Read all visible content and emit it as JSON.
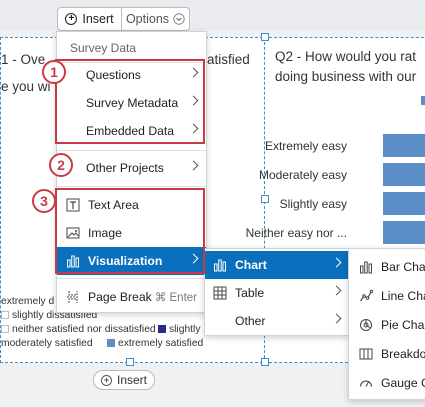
{
  "toolbar": {
    "insert_label": "Insert",
    "options_label": "Options"
  },
  "left_widget": {
    "title_line1": "1 - Ove",
    "title_line1_right": "atisfied",
    "title_line2": "e you wi",
    "legend": [
      {
        "label": "extremely d",
        "color": "#2a2a8a"
      },
      {
        "label": "slightly dissatisfied",
        "color": "#ffffff"
      },
      {
        "label": "neither satisfied nor dissatisfied",
        "color": "#ffffff"
      },
      {
        "label": "slightly",
        "color": "#2a2a8a"
      },
      {
        "label": "moderately satisfied",
        "color": "#ffffff"
      },
      {
        "label": "extremely satisfied",
        "color": "#5b8ec6"
      }
    ]
  },
  "right_widget": {
    "title_line1": "Q2 - How would you rat",
    "title_line2": "doing business with our",
    "chart_data": {
      "type": "bar",
      "categories": [
        "Extremely easy",
        "Moderately easy",
        "Slightly easy",
        "Neither easy nor ..."
      ]
    }
  },
  "bottom_insert_label": "Insert",
  "menu": {
    "header": "Survey Data",
    "items": [
      {
        "label": "Questions"
      },
      {
        "label": "Survey Metadata"
      },
      {
        "label": "Embedded Data"
      },
      {
        "label": "Other Projects"
      },
      {
        "label": "Text Area"
      },
      {
        "label": "Image"
      },
      {
        "label": "Visualization"
      },
      {
        "label": "Page Break",
        "shortcut": "⌘ Enter"
      }
    ]
  },
  "submenu": {
    "items": [
      {
        "label": "Chart"
      },
      {
        "label": "Table"
      },
      {
        "label": "Other"
      }
    ]
  },
  "chart_menu": {
    "items": [
      {
        "label": "Bar Char"
      },
      {
        "label": "Line Char"
      },
      {
        "label": "Pie Char"
      },
      {
        "label": "Breakdow"
      },
      {
        "label": "Gauge C"
      }
    ]
  },
  "callouts": [
    "1",
    "2",
    "3"
  ],
  "colors": {
    "accent": "#0a6fbd",
    "callout": "#c93a45",
    "bar": "#5b8ec6"
  }
}
